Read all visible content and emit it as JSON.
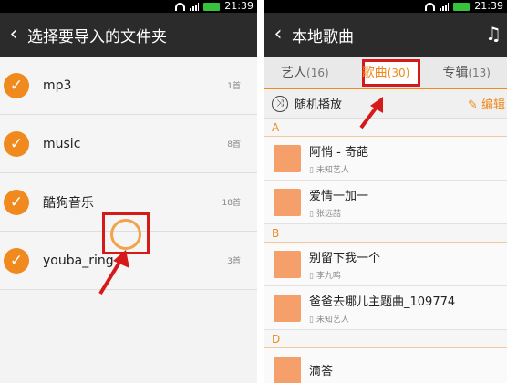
{
  "colors": {
    "accent": "#f08a1e",
    "highlight": "#d61a1a"
  },
  "left": {
    "status": {
      "time": "21:39"
    },
    "title": "选择要导入的文件夹",
    "folders": [
      {
        "name": "mp3",
        "count": "1首"
      },
      {
        "name": "music",
        "count": "8首"
      },
      {
        "name": "酷狗音乐",
        "count": "18首"
      },
      {
        "name": "youba_ring",
        "count": "3首"
      }
    ]
  },
  "right": {
    "status": {
      "time": "21:39"
    },
    "title": "本地歌曲",
    "tabs": [
      {
        "label": "艺人",
        "count": "(16)"
      },
      {
        "label": "歌曲",
        "count": "(30)"
      },
      {
        "label": "专辑",
        "count": "(13)"
      }
    ],
    "shuffle_label": "随机播放",
    "edit_label": "编辑",
    "sections": [
      {
        "letter": "A",
        "songs": [
          {
            "title": "阿悄 - 奇葩",
            "artist": "未知艺人"
          },
          {
            "title": "爱情一加一",
            "artist": "张远喆"
          }
        ]
      },
      {
        "letter": "B",
        "songs": [
          {
            "title": "别留下我一个",
            "artist": "李九鸣"
          },
          {
            "title": "爸爸去哪儿主题曲_109774",
            "artist": "未知艺人"
          }
        ]
      },
      {
        "letter": "D",
        "songs": [
          {
            "title": "滴答",
            "artist": ""
          }
        ]
      }
    ]
  }
}
